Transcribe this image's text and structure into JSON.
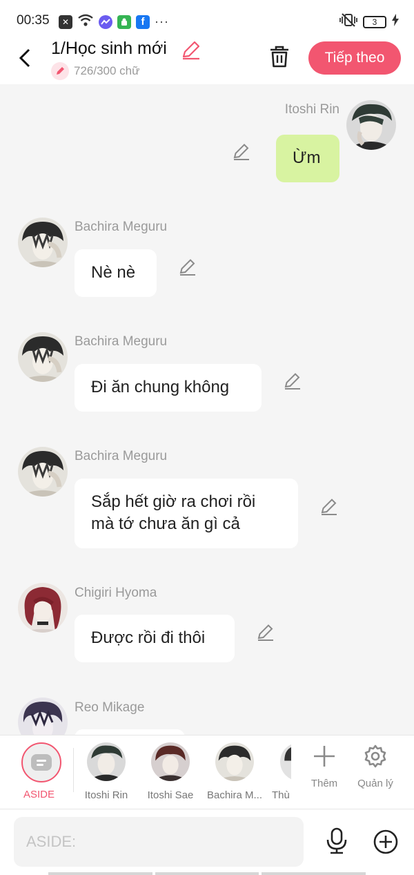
{
  "status_bar": {
    "time": "00:35",
    "icons": [
      "close-box-icon",
      "wifi-icon",
      "messenger-icon",
      "android-icon",
      "facebook-icon",
      "more-icon"
    ],
    "more_text": "···",
    "battery": "3"
  },
  "header": {
    "title": "1/Học sinh mới",
    "subtitle": "726/300 chữ",
    "next_label": "Tiếp theo",
    "accent": "#f25670"
  },
  "messages": [
    {
      "sender": "Itoshi Rin",
      "text": "Ừm",
      "side": "right"
    },
    {
      "sender": "Bachira Meguru",
      "text": "Nè nè",
      "side": "left"
    },
    {
      "sender": "Bachira Meguru",
      "text": "Đi ăn chung không",
      "side": "left"
    },
    {
      "sender": "Bachira Meguru",
      "text_line1": "Sắp hết giờ ra chơi rồi",
      "text_line2": "mà tớ chưa ăn gì cả",
      "side": "left"
    },
    {
      "sender": "Chigiri Hyoma",
      "text": "Được rồi đi thôi",
      "side": "left"
    },
    {
      "sender": "Reo Mikage",
      "text": "",
      "side": "left"
    }
  ],
  "characters": {
    "aside_label": "ASIDE",
    "items": [
      {
        "label": "Itoshi Rin"
      },
      {
        "label": "Itoshi Sae"
      },
      {
        "label": "Bachira M..."
      },
      {
        "label": "Thù"
      }
    ],
    "add_label": "Thêm",
    "manage_label": "Quản lý"
  },
  "input": {
    "placeholder": "ASIDE:"
  }
}
